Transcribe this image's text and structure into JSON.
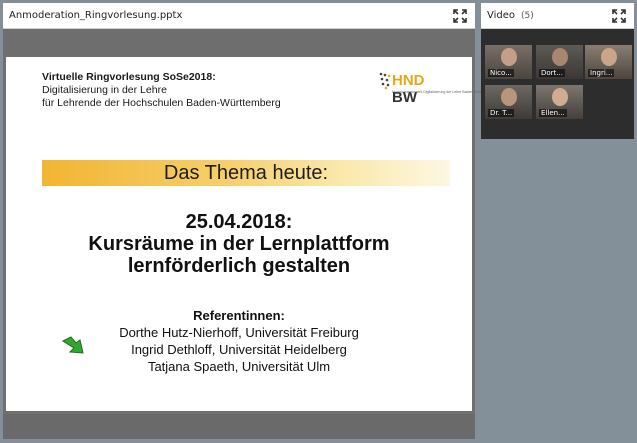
{
  "share_pod": {
    "title": "Anmoderation_Ringvorlesung.pptx",
    "slide": {
      "header_line1": "Virtuelle Ringvorlesung SoSe2018:",
      "header_line2": "Digitalisierung in der Lehre",
      "header_line3": "für Lehrende der Hochschulen Baden-Württemberg",
      "logo_hnd": "HND",
      "logo_bw": " BW",
      "logo_sub": "Hochschulnetzwerk Digitalisierung der Lehre Baden-Württemberg",
      "theme_heading": "Das Thema heute:",
      "date_line": "25.04.2018:",
      "title_line1": "Kursräume in der Lernplattform",
      "title_line2": "lernförderlich gestalten",
      "referents_label": "Referentinnen:",
      "referents": [
        "Dorthe Hutz-Nierhoff, Universität Freiburg",
        "Ingrid Dethloff, Universität Heidelberg",
        "Tatjana Spaeth, Universität Ulm"
      ]
    }
  },
  "video_pod": {
    "title": "Video",
    "count": "(5)",
    "participants": [
      {
        "name": "Nico..."
      },
      {
        "name": "Dort..."
      },
      {
        "name": "Ingri..."
      },
      {
        "name": "Dr. T..."
      },
      {
        "name": "Ellen..."
      }
    ]
  },
  "colors": {
    "background": "#838f99",
    "theme_bar": "#f1b533",
    "arrow": "#2ea82e",
    "logo_accent": "#e6a817"
  },
  "icons": {
    "expand": "expand-icon",
    "arrow": "green-arrow-icon",
    "logo_dots": "logo-dots-icon"
  }
}
